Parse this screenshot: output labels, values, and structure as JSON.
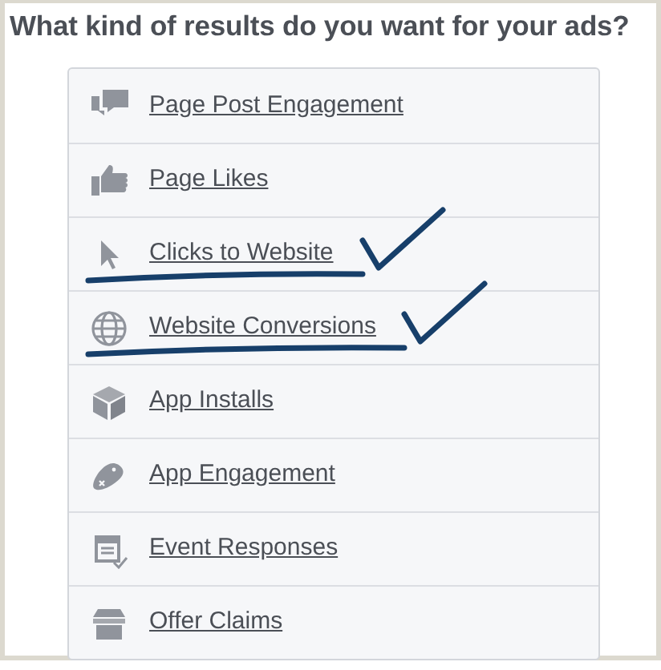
{
  "title": "What kind of results do you want for your ads?",
  "options": [
    {
      "label": "Page Post Engagement",
      "annotated": false
    },
    {
      "label": "Page Likes",
      "annotated": false
    },
    {
      "label": "Clicks to Website",
      "annotated": true
    },
    {
      "label": "Website Conversions",
      "annotated": true
    },
    {
      "label": "App Installs",
      "annotated": false
    },
    {
      "label": "App Engagement",
      "annotated": false
    },
    {
      "label": "Event Responses",
      "annotated": false
    },
    {
      "label": "Offer Claims",
      "annotated": false
    }
  ]
}
